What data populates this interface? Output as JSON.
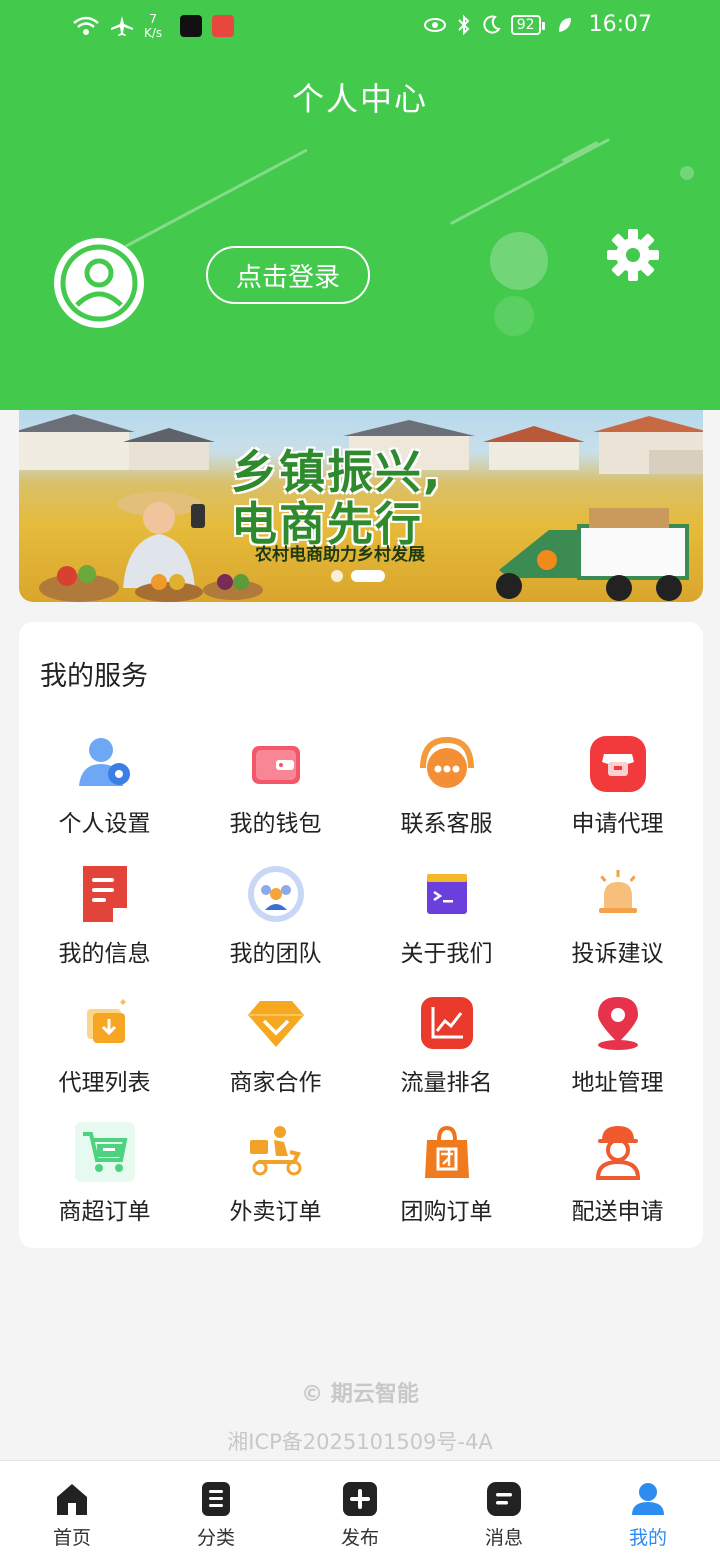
{
  "status_bar": {
    "net_speed_value": "7",
    "net_speed_unit": "K/s",
    "battery": "92",
    "time": "16:07"
  },
  "header": {
    "title": "个人中心",
    "login_label": "点击登录"
  },
  "banner": {
    "headline_line1": "乡镇振兴,",
    "headline_line2": "电商先行",
    "subtitle": "农村电商助力乡村发展",
    "slide_count": 2,
    "active_slide": 2
  },
  "services": {
    "title": "我的服务",
    "items": [
      {
        "label": "个人设置",
        "icon": "user-settings-icon"
      },
      {
        "label": "我的钱包",
        "icon": "wallet-icon"
      },
      {
        "label": "联系客服",
        "icon": "headset-icon"
      },
      {
        "label": "申请代理",
        "icon": "shop-icon"
      },
      {
        "label": "我的信息",
        "icon": "document-icon"
      },
      {
        "label": "我的团队",
        "icon": "team-icon"
      },
      {
        "label": "关于我们",
        "icon": "terminal-icon"
      },
      {
        "label": "投诉建议",
        "icon": "alarm-icon"
      },
      {
        "label": "代理列表",
        "icon": "download-box-icon"
      },
      {
        "label": "商家合作",
        "icon": "diamond-icon"
      },
      {
        "label": "流量排名",
        "icon": "trend-chart-icon"
      },
      {
        "label": "地址管理",
        "icon": "location-pin-icon"
      },
      {
        "label": "商超订单",
        "icon": "cart-icon"
      },
      {
        "label": "外卖订单",
        "icon": "delivery-scooter-icon"
      },
      {
        "label": "团购订单",
        "icon": "group-buy-bag-icon"
      },
      {
        "label": "配送申请",
        "icon": "courier-icon"
      }
    ]
  },
  "footer": {
    "copyright": "© 期云智能",
    "icp": "湘ICP备2025101509号-4A"
  },
  "tabbar": {
    "items": [
      {
        "label": "首页",
        "icon": "home-icon"
      },
      {
        "label": "分类",
        "icon": "category-list-icon"
      },
      {
        "label": "发布",
        "icon": "plus-icon"
      },
      {
        "label": "消息",
        "icon": "message-icon"
      },
      {
        "label": "我的",
        "icon": "profile-icon"
      }
    ],
    "active_index": 4
  },
  "colors": {
    "header_green": "#43c94c",
    "active_tab_blue": "#2d8cf0",
    "banner_text_green": "#2f8a2e"
  }
}
